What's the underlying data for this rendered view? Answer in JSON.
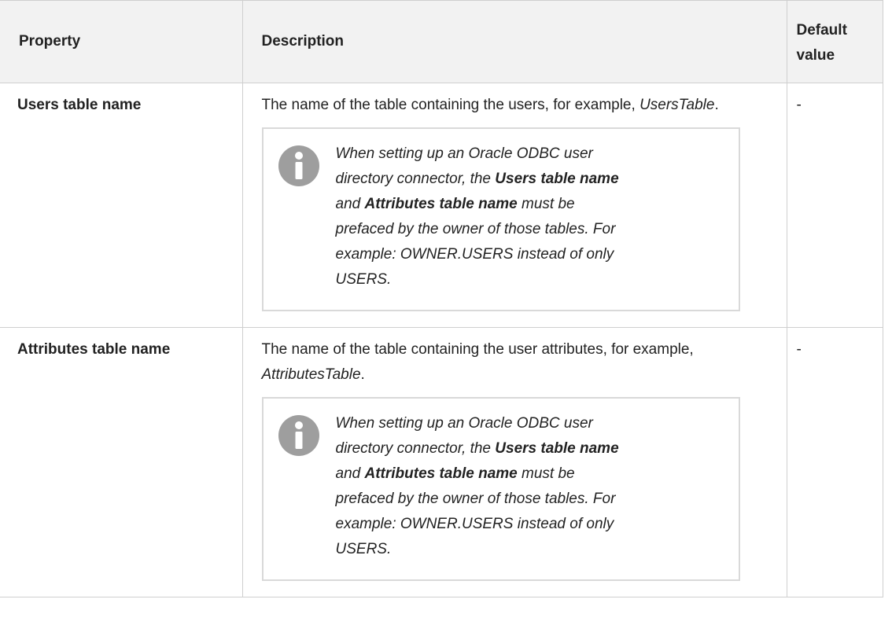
{
  "table": {
    "headers": {
      "property": "Property",
      "description": "Description",
      "default_line1": "Default",
      "default_line2": "value"
    },
    "rows": [
      {
        "property": "Users table name",
        "desc_before": "The name of the table containing the users, for example, ",
        "desc_italic": "UsersTable",
        "desc_after": ".",
        "default": "-",
        "note": {
          "icon": "info-icon",
          "t1": "When setting up an Oracle ODBC user directory connector, the ",
          "b1": "Users table name",
          "t2": " and ",
          "b2": "Attributes table name",
          "t3": " must be prefaced by the owner of those tables. For example: OWNER.USERS instead of only USERS."
        }
      },
      {
        "property": "Attributes table name",
        "desc_before": "The name of the table containing the user attributes, for example, ",
        "desc_italic": "AttributesTable",
        "desc_after": ".",
        "default": "-",
        "note": {
          "icon": "info-icon",
          "t1": "When setting up an Oracle ODBC user directory connector, the ",
          "b1": "Users table name",
          "t2": " and ",
          "b2": "Attributes table name",
          "t3": " must be prefaced by the owner of those tables. For example: OWNER.USERS instead of only USERS."
        }
      }
    ]
  },
  "colors": {
    "header_bg": "#f2f2f2",
    "border": "#cfcfcf",
    "note_border": "#d9d9d9",
    "icon_gray": "#9e9e9e"
  }
}
